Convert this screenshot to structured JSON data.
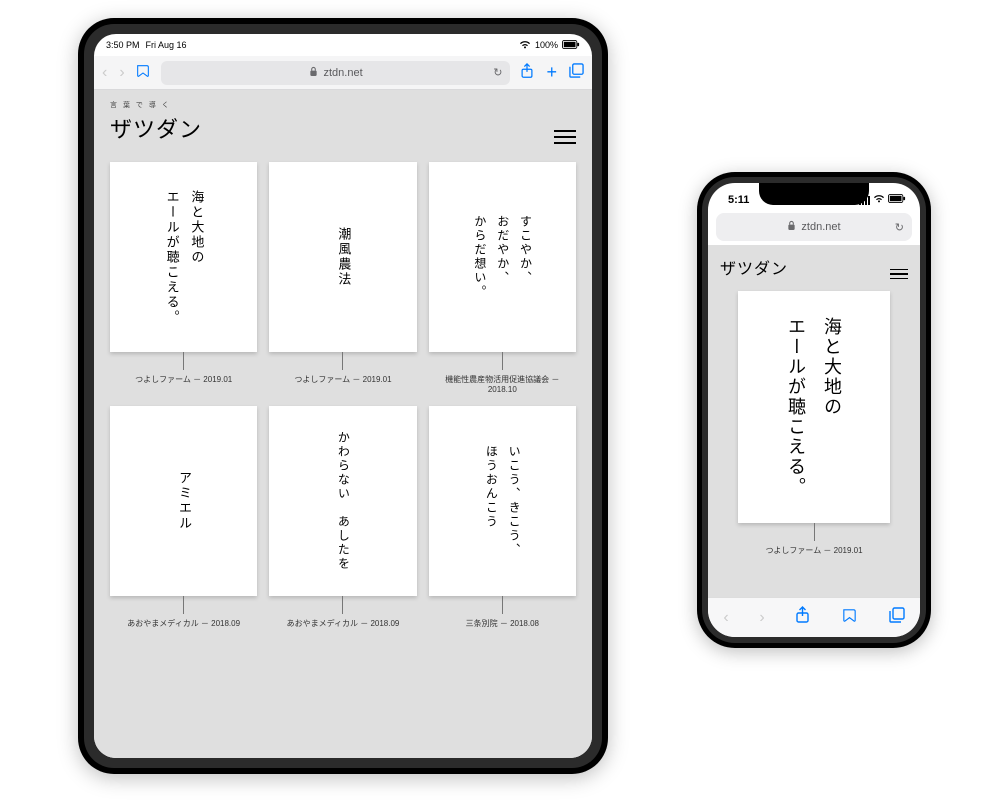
{
  "ipad": {
    "status": {
      "time": "3:50 PM",
      "date": "Fri Aug 16",
      "battery_text": "100%"
    },
    "address_bar": {
      "domain": "ztdn.net"
    },
    "site": {
      "tagline": "言 葉 で 導 く",
      "logo_text": "ザツダン"
    },
    "cards": [
      {
        "text": "海と大地の\nエールが聴こえる。",
        "caption": "つよしファーム － 2019.01"
      },
      {
        "text": "潮風農法",
        "caption": "つよしファーム － 2019.01"
      },
      {
        "text": "すこやか、\nおだやか、\nからだ想い。",
        "caption": "機能性農産物活用促進協議会 － 2018.10"
      },
      {
        "text": "アミエル",
        "caption": "あおやまメディカル － 2018.09"
      },
      {
        "text": "かわらない　あしたを",
        "caption": "あおやまメディカル － 2018.09"
      },
      {
        "text": "いこう、きこう、\nほうおんこう",
        "caption": "三条別院 － 2018.08"
      }
    ]
  },
  "iphone": {
    "status": {
      "time": "5:11"
    },
    "address_bar": {
      "domain": "ztdn.net"
    },
    "site": {
      "logo_text": "ザツダン"
    },
    "card": {
      "text": "海と大地の\nエールが聴こえる。",
      "caption": "つよしファーム － 2019.01"
    }
  }
}
